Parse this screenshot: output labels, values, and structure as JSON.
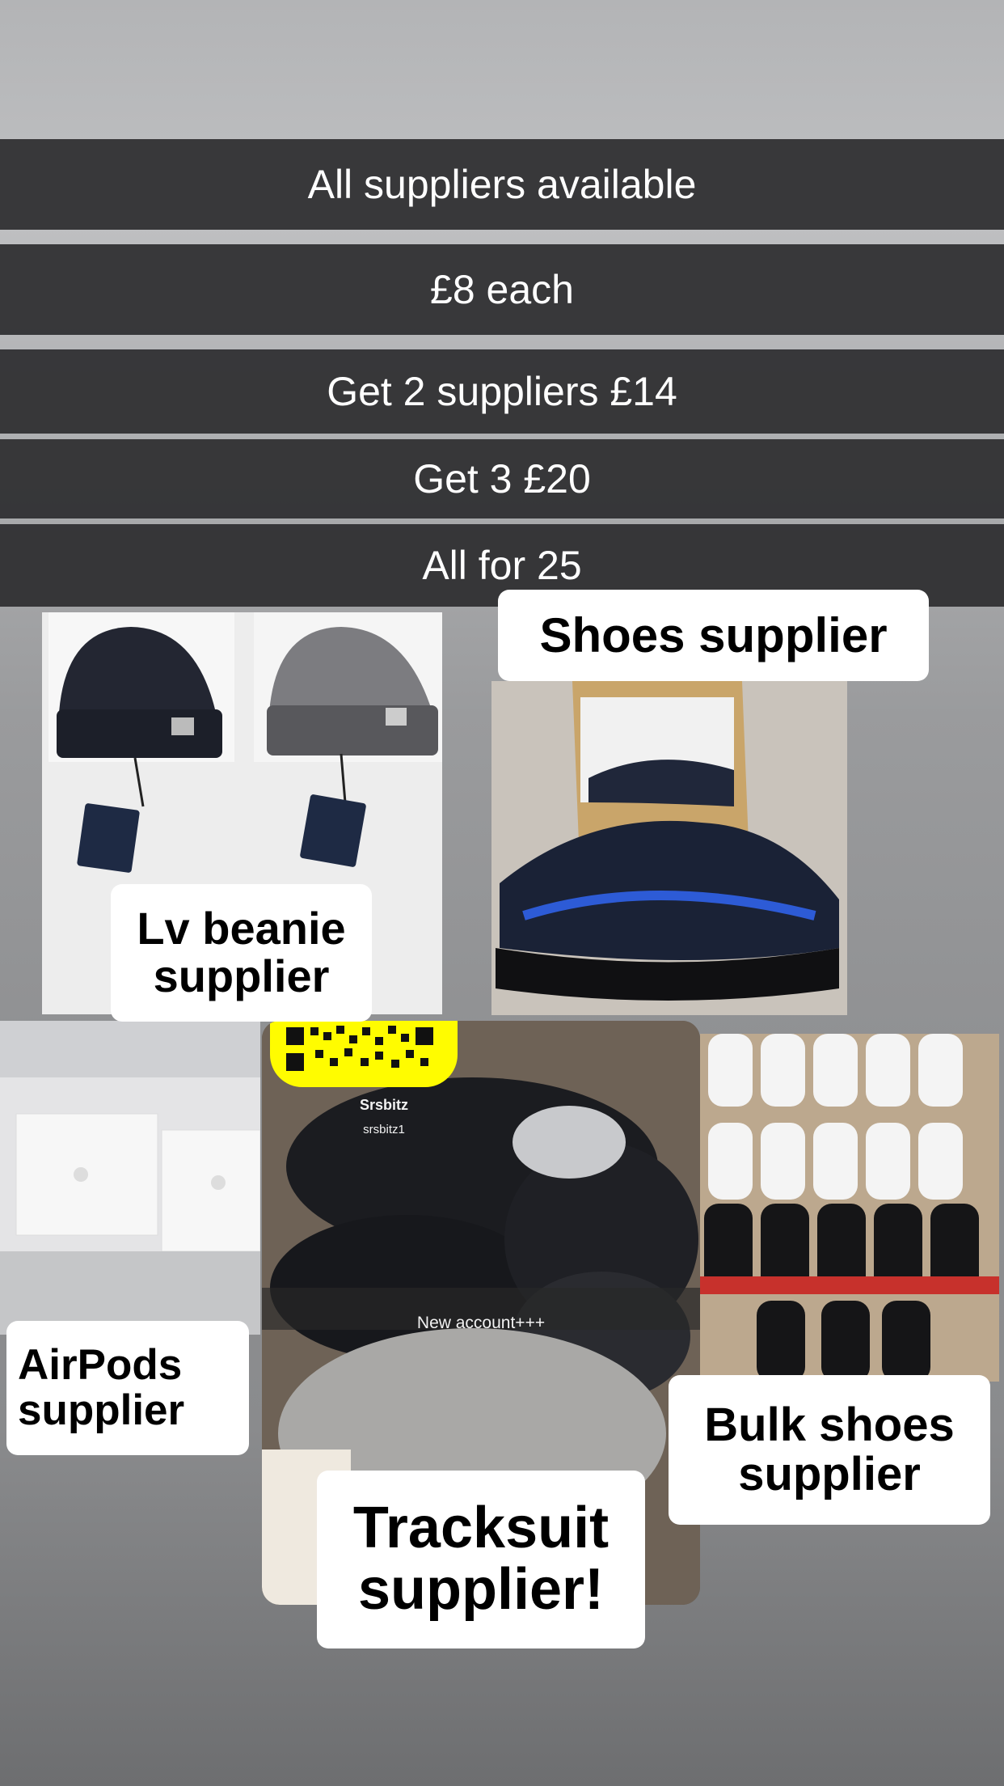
{
  "banners": [
    "All suppliers available",
    "£8 each",
    "Get 2 suppliers £14",
    "Get 3 £20",
    "All for 25"
  ],
  "labels": {
    "beanie": "Lv beanie supplier",
    "shoes": "Shoes supplier",
    "airpods": "AirPods supplier",
    "tracksuit": "Tracksuit supplier!",
    "bulk": "Bulk shoes supplier"
  },
  "snap": {
    "name": "Srsbitz",
    "username": "srsbitz1",
    "caption": "New account+++"
  },
  "colors": {
    "banner_bg": "#2d2d2f",
    "label_bg": "#ffffff",
    "snapcode_yellow": "#fffc00"
  }
}
